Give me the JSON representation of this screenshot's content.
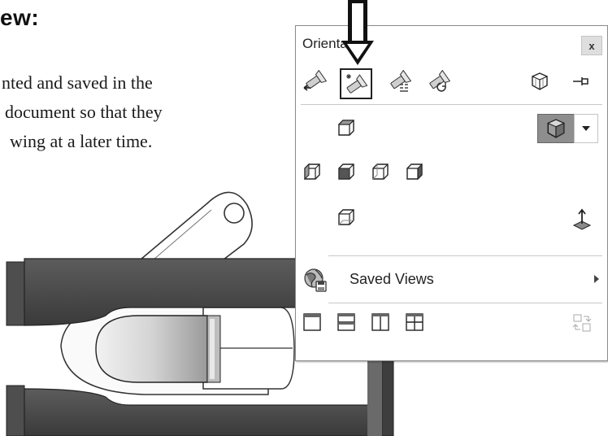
{
  "document": {
    "heading_fragment": "ew:",
    "body_lines": [
      "nted and saved in the",
      "document so that they",
      "wing at a later time."
    ]
  },
  "orientation_panel": {
    "title": "Orientation",
    "close_label": "x",
    "saved_views_label": "Saved Views",
    "toolbar_icons": [
      "previous-view-icon",
      "new-view-icon",
      "update-standard-views-icon",
      "reset-standard-views-icon",
      "view-selector-icon",
      "pin-icon"
    ],
    "view_icons": [
      "top-view-icon",
      "left-view-icon",
      "front-view-icon",
      "right-view-icon",
      "back-view-icon",
      "bottom-view-icon",
      "isometric-view-icon",
      "normal-to-icon"
    ],
    "viewport_icons": [
      "single-view-icon",
      "two-view-horizontal-icon",
      "two-view-vertical-icon",
      "four-view-icon",
      "link-views-icon"
    ]
  },
  "colors": {
    "panel_border": "#8c8c8c",
    "highlight": "#888888",
    "part_dark": "#4a4a4a"
  }
}
